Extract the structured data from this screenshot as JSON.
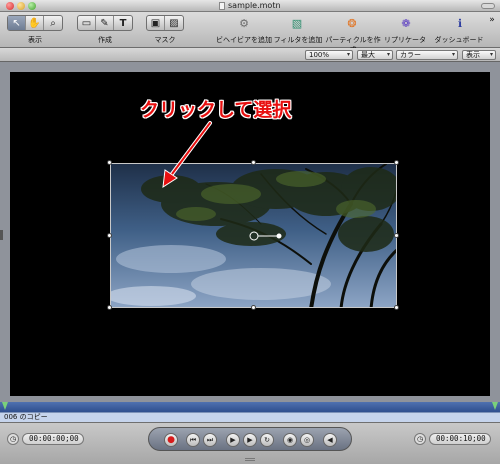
{
  "window": {
    "title": "sample.motn"
  },
  "toolbar": {
    "groups": [
      {
        "label": "表示",
        "segments": [
          "selection-arrow",
          "hand",
          "zoom"
        ]
      },
      {
        "label": "作成",
        "segments": [
          "rectangle",
          "bezier",
          "text"
        ]
      },
      {
        "label": "マスク",
        "segments": [
          "mask-rectangle",
          "mask-bezier"
        ]
      }
    ],
    "actions": [
      {
        "label": "ビヘイビアを追加",
        "icon": "behavior-gear-icon"
      },
      {
        "label": "フィルタを追加",
        "icon": "filter-icon"
      },
      {
        "label": "パーティクルを作成",
        "icon": "particle-icon"
      },
      {
        "label": "リプリケータ",
        "icon": "replicator-icon"
      },
      {
        "label": "ダッシュボード",
        "icon": "dashboard-info-icon"
      }
    ],
    "overflow": "»"
  },
  "view_options": {
    "zoom": "100%",
    "resolution": "最大",
    "channel": "カラー",
    "display": "表示"
  },
  "canvas": {
    "annotation": "クリックして選択"
  },
  "timeline": {
    "layer_name": "006 のコピー"
  },
  "transport": {
    "current_time": "00:00:00;00",
    "duration": "00:00:10;00",
    "buttons": [
      "record",
      "go-to-start",
      "play-range-start",
      "play",
      "pause",
      "loop",
      "audio",
      "mute",
      "go-to-end"
    ]
  }
}
